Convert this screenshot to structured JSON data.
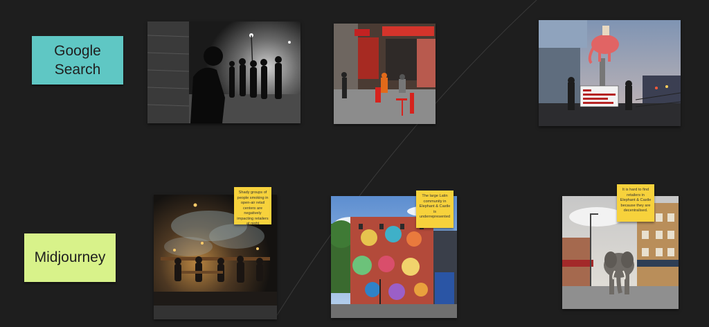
{
  "board": {
    "background": "#1e1e1e"
  },
  "rows": [
    {
      "label": "Google Search",
      "label_color": "#5fc7c4",
      "images": [
        {
          "icon": "night-street-photo"
        },
        {
          "icon": "cafe-storefront-photo"
        },
        {
          "icon": "protest-elephant-photo",
          "sign_text": "STOP the DISPLACEMENT of MIGRANT & ETHNIC TRADERS"
        }
      ]
    },
    {
      "label": "Midjourney",
      "label_color": "#d8f28a",
      "images": [
        {
          "icon": "smoky-market-image",
          "note": "Shady groups of people smoking in open-air retail centers are negatively impacting retailers at night"
        },
        {
          "icon": "mural-building-image",
          "note": "The large Latin community in Elephant & Castle is underrepresented"
        },
        {
          "icon": "elephant-street-image",
          "note": "It is hard to find retailers in Elephant & Castle because they are decentralised."
        }
      ]
    }
  ],
  "sticky_color": "#f7d23c"
}
